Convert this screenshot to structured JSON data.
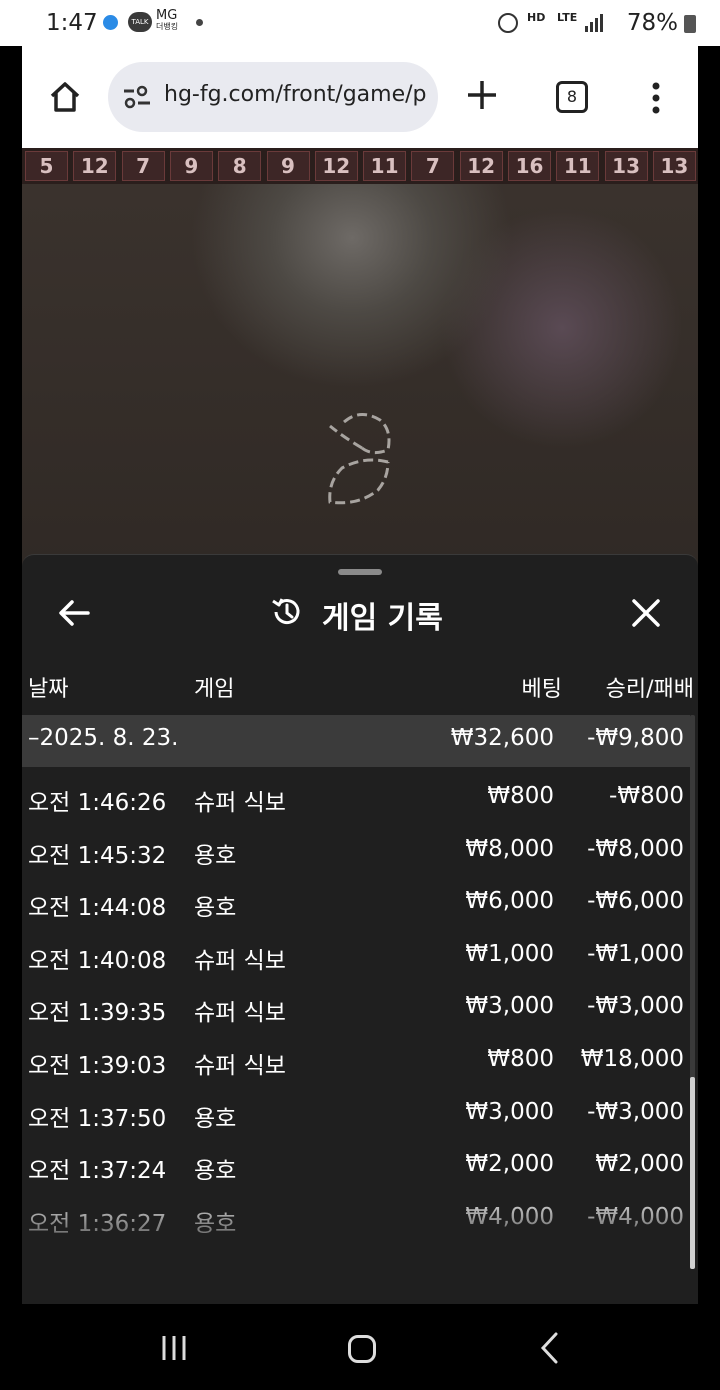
{
  "status_bar": {
    "time": "1:47",
    "notif_talk": "TALK",
    "notif_mg": "MG",
    "notif_mg_sub": "더뱅킹",
    "hd": "HD",
    "lte": "LTE",
    "battery": "78%"
  },
  "browser": {
    "url": "hg-fg.com/front/game/pla",
    "tab_count": "8"
  },
  "roadmap": [
    "5",
    "12",
    "7",
    "9",
    "8",
    "9",
    "12",
    "11",
    "7",
    "12",
    "16",
    "11",
    "13",
    "13"
  ],
  "panel": {
    "title": "게임 기록",
    "columns": {
      "date": "날짜",
      "game": "게임",
      "bet": "베팅",
      "win_loss": "승리/패배"
    },
    "summary": {
      "date": "–2025. 8. 23.",
      "bet": "₩32,600",
      "win_loss": "-₩9,800"
    },
    "rows": [
      {
        "time": "오전 1:46:26",
        "game": "슈퍼 식보",
        "bet": "₩800",
        "win_loss": "-₩800"
      },
      {
        "time": "오전 1:45:32",
        "game": "용호",
        "bet": "₩8,000",
        "win_loss": "-₩8,000"
      },
      {
        "time": "오전 1:44:08",
        "game": "용호",
        "bet": "₩6,000",
        "win_loss": "-₩6,000"
      },
      {
        "time": "오전 1:40:08",
        "game": "슈퍼 식보",
        "bet": "₩1,000",
        "win_loss": "-₩1,000"
      },
      {
        "time": "오전 1:39:35",
        "game": "슈퍼 식보",
        "bet": "₩3,000",
        "win_loss": "-₩3,000"
      },
      {
        "time": "오전 1:39:03",
        "game": "슈퍼 식보",
        "bet": "₩800",
        "win_loss": "₩18,000"
      },
      {
        "time": "오전 1:37:50",
        "game": "용호",
        "bet": "₩3,000",
        "win_loss": "-₩3,000"
      },
      {
        "time": "오전 1:37:24",
        "game": "용호",
        "bet": "₩2,000",
        "win_loss": "₩2,000"
      },
      {
        "time": "오전 1:36:27",
        "game": "용호",
        "bet": "₩4,000",
        "win_loss": "-₩4,000"
      }
    ]
  }
}
